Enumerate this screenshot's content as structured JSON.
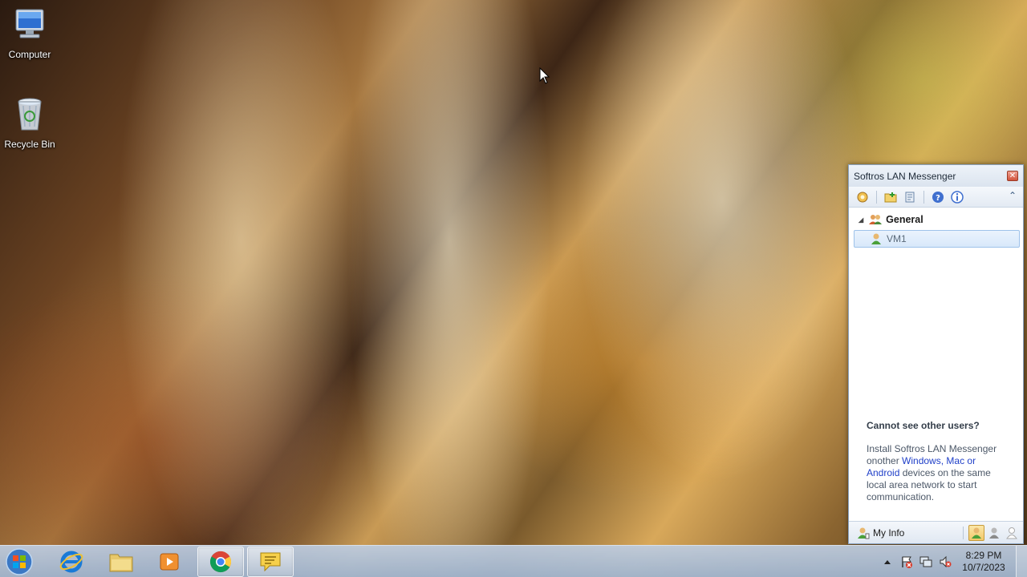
{
  "desktop": {
    "icons": [
      {
        "label": "Computer",
        "icon": "computer-icon"
      },
      {
        "label": "Recycle Bin",
        "icon": "recycle-bin-icon"
      }
    ]
  },
  "messenger": {
    "title": "Softros LAN Messenger",
    "toolbar": {
      "buttons": [
        "settings-icon",
        "add-folder-icon",
        "history-icon",
        "help-icon",
        "info-icon"
      ]
    },
    "group": {
      "name": "General"
    },
    "contacts": [
      {
        "name": "VM1"
      }
    ],
    "help": {
      "title": "Cannot see other users?",
      "text_before": "Install Softros LAN Messenger onother ",
      "link": "Windows, Mac or Android",
      "text_after": " devices on the same local area network to start communication."
    },
    "status_bar": {
      "my_info": "My Info",
      "statuses": [
        "available-status-icon",
        "away-status-icon",
        "offline-status-icon"
      ]
    }
  },
  "taskbar": {
    "apps": [
      {
        "name": "internet-explorer-icon",
        "running": false
      },
      {
        "name": "file-explorer-icon",
        "running": false
      },
      {
        "name": "media-player-icon",
        "running": false
      },
      {
        "name": "chrome-icon",
        "running": true
      },
      {
        "name": "lan-messenger-icon",
        "running": true
      }
    ],
    "clock": {
      "time": "8:29 PM",
      "date": "10/7/2023"
    }
  },
  "colors": {
    "link": "#1f3fc8",
    "window_border": "#8aa3c1",
    "selection": "#d8e8fa"
  }
}
